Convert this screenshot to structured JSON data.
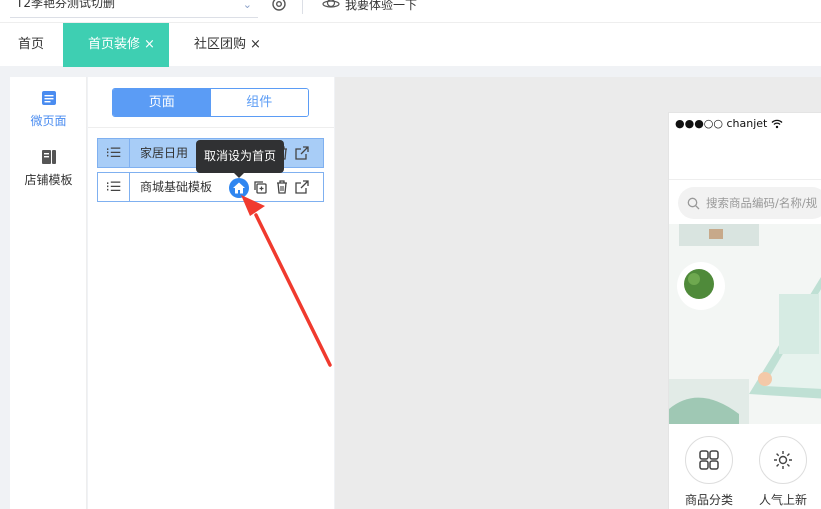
{
  "topbar": {
    "tenant_name": "T2季艳芬测试切删",
    "experience_label": "我要体验一下"
  },
  "tabs": [
    {
      "label": "首页",
      "closable": false,
      "active": false
    },
    {
      "label": "首页装修",
      "closable": true,
      "active": true
    },
    {
      "label": "社区团购",
      "closable": true,
      "active": false
    }
  ],
  "tab_close_glyph": "×",
  "leftnav": {
    "items": [
      {
        "label": "微页面",
        "icon": "micro-page-icon",
        "active": true
      },
      {
        "label": "店铺模板",
        "icon": "store-template-icon",
        "active": false
      }
    ]
  },
  "panel": {
    "segment": {
      "page": "页面",
      "component": "组件"
    },
    "pages": [
      {
        "name": "家居日用",
        "selected": true
      },
      {
        "name": "商城基础模板",
        "selected": false
      }
    ],
    "handle_glyph": "⁝☰",
    "tooltip": "取消设为首页"
  },
  "preview": {
    "carrier": "●●●○○ chanjet",
    "search_placeholder": "搜索商品编码/名称/规",
    "categories": [
      {
        "label": "商品分类",
        "icon": "grid-icon"
      },
      {
        "label": "人气上新",
        "icon": "sun-icon"
      }
    ]
  },
  "colors": {
    "accent_blue": "#5b9cf5",
    "active_tab": "#3ecfb2",
    "arrow_red": "#f03a2e"
  }
}
